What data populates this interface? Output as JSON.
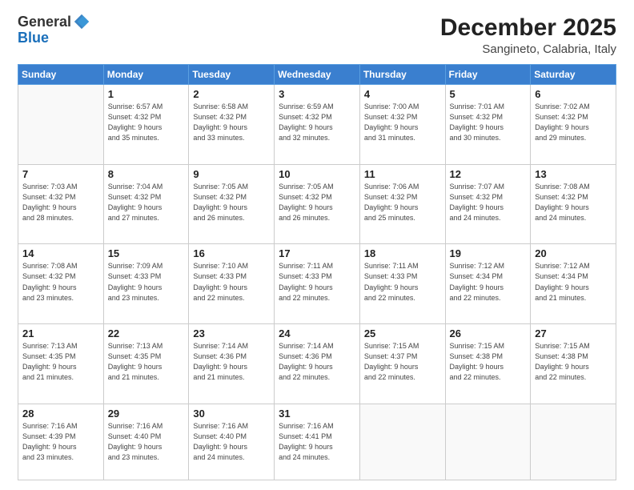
{
  "logo": {
    "general": "General",
    "blue": "Blue"
  },
  "header": {
    "month": "December 2025",
    "location": "Sangineto, Calabria, Italy"
  },
  "weekdays": [
    "Sunday",
    "Monday",
    "Tuesday",
    "Wednesday",
    "Thursday",
    "Friday",
    "Saturday"
  ],
  "weeks": [
    [
      {
        "day": "",
        "sunrise": "",
        "sunset": "",
        "daylight": ""
      },
      {
        "day": "1",
        "sunrise": "Sunrise: 6:57 AM",
        "sunset": "Sunset: 4:32 PM",
        "daylight": "Daylight: 9 hours and 35 minutes."
      },
      {
        "day": "2",
        "sunrise": "Sunrise: 6:58 AM",
        "sunset": "Sunset: 4:32 PM",
        "daylight": "Daylight: 9 hours and 33 minutes."
      },
      {
        "day": "3",
        "sunrise": "Sunrise: 6:59 AM",
        "sunset": "Sunset: 4:32 PM",
        "daylight": "Daylight: 9 hours and 32 minutes."
      },
      {
        "day": "4",
        "sunrise": "Sunrise: 7:00 AM",
        "sunset": "Sunset: 4:32 PM",
        "daylight": "Daylight: 9 hours and 31 minutes."
      },
      {
        "day": "5",
        "sunrise": "Sunrise: 7:01 AM",
        "sunset": "Sunset: 4:32 PM",
        "daylight": "Daylight: 9 hours and 30 minutes."
      },
      {
        "day": "6",
        "sunrise": "Sunrise: 7:02 AM",
        "sunset": "Sunset: 4:32 PM",
        "daylight": "Daylight: 9 hours and 29 minutes."
      }
    ],
    [
      {
        "day": "7",
        "sunrise": "Sunrise: 7:03 AM",
        "sunset": "Sunset: 4:32 PM",
        "daylight": "Daylight: 9 hours and 28 minutes."
      },
      {
        "day": "8",
        "sunrise": "Sunrise: 7:04 AM",
        "sunset": "Sunset: 4:32 PM",
        "daylight": "Daylight: 9 hours and 27 minutes."
      },
      {
        "day": "9",
        "sunrise": "Sunrise: 7:05 AM",
        "sunset": "Sunset: 4:32 PM",
        "daylight": "Daylight: 9 hours and 26 minutes."
      },
      {
        "day": "10",
        "sunrise": "Sunrise: 7:05 AM",
        "sunset": "Sunset: 4:32 PM",
        "daylight": "Daylight: 9 hours and 26 minutes."
      },
      {
        "day": "11",
        "sunrise": "Sunrise: 7:06 AM",
        "sunset": "Sunset: 4:32 PM",
        "daylight": "Daylight: 9 hours and 25 minutes."
      },
      {
        "day": "12",
        "sunrise": "Sunrise: 7:07 AM",
        "sunset": "Sunset: 4:32 PM",
        "daylight": "Daylight: 9 hours and 24 minutes."
      },
      {
        "day": "13",
        "sunrise": "Sunrise: 7:08 AM",
        "sunset": "Sunset: 4:32 PM",
        "daylight": "Daylight: 9 hours and 24 minutes."
      }
    ],
    [
      {
        "day": "14",
        "sunrise": "Sunrise: 7:08 AM",
        "sunset": "Sunset: 4:32 PM",
        "daylight": "Daylight: 9 hours and 23 minutes."
      },
      {
        "day": "15",
        "sunrise": "Sunrise: 7:09 AM",
        "sunset": "Sunset: 4:33 PM",
        "daylight": "Daylight: 9 hours and 23 minutes."
      },
      {
        "day": "16",
        "sunrise": "Sunrise: 7:10 AM",
        "sunset": "Sunset: 4:33 PM",
        "daylight": "Daylight: 9 hours and 22 minutes."
      },
      {
        "day": "17",
        "sunrise": "Sunrise: 7:11 AM",
        "sunset": "Sunset: 4:33 PM",
        "daylight": "Daylight: 9 hours and 22 minutes."
      },
      {
        "day": "18",
        "sunrise": "Sunrise: 7:11 AM",
        "sunset": "Sunset: 4:33 PM",
        "daylight": "Daylight: 9 hours and 22 minutes."
      },
      {
        "day": "19",
        "sunrise": "Sunrise: 7:12 AM",
        "sunset": "Sunset: 4:34 PM",
        "daylight": "Daylight: 9 hours and 22 minutes."
      },
      {
        "day": "20",
        "sunrise": "Sunrise: 7:12 AM",
        "sunset": "Sunset: 4:34 PM",
        "daylight": "Daylight: 9 hours and 21 minutes."
      }
    ],
    [
      {
        "day": "21",
        "sunrise": "Sunrise: 7:13 AM",
        "sunset": "Sunset: 4:35 PM",
        "daylight": "Daylight: 9 hours and 21 minutes."
      },
      {
        "day": "22",
        "sunrise": "Sunrise: 7:13 AM",
        "sunset": "Sunset: 4:35 PM",
        "daylight": "Daylight: 9 hours and 21 minutes."
      },
      {
        "day": "23",
        "sunrise": "Sunrise: 7:14 AM",
        "sunset": "Sunset: 4:36 PM",
        "daylight": "Daylight: 9 hours and 21 minutes."
      },
      {
        "day": "24",
        "sunrise": "Sunrise: 7:14 AM",
        "sunset": "Sunset: 4:36 PM",
        "daylight": "Daylight: 9 hours and 22 minutes."
      },
      {
        "day": "25",
        "sunrise": "Sunrise: 7:15 AM",
        "sunset": "Sunset: 4:37 PM",
        "daylight": "Daylight: 9 hours and 22 minutes."
      },
      {
        "day": "26",
        "sunrise": "Sunrise: 7:15 AM",
        "sunset": "Sunset: 4:38 PM",
        "daylight": "Daylight: 9 hours and 22 minutes."
      },
      {
        "day": "27",
        "sunrise": "Sunrise: 7:15 AM",
        "sunset": "Sunset: 4:38 PM",
        "daylight": "Daylight: 9 hours and 22 minutes."
      }
    ],
    [
      {
        "day": "28",
        "sunrise": "Sunrise: 7:16 AM",
        "sunset": "Sunset: 4:39 PM",
        "daylight": "Daylight: 9 hours and 23 minutes."
      },
      {
        "day": "29",
        "sunrise": "Sunrise: 7:16 AM",
        "sunset": "Sunset: 4:40 PM",
        "daylight": "Daylight: 9 hours and 23 minutes."
      },
      {
        "day": "30",
        "sunrise": "Sunrise: 7:16 AM",
        "sunset": "Sunset: 4:40 PM",
        "daylight": "Daylight: 9 hours and 24 minutes."
      },
      {
        "day": "31",
        "sunrise": "Sunrise: 7:16 AM",
        "sunset": "Sunset: 4:41 PM",
        "daylight": "Daylight: 9 hours and 24 minutes."
      },
      {
        "day": "",
        "sunrise": "",
        "sunset": "",
        "daylight": ""
      },
      {
        "day": "",
        "sunrise": "",
        "sunset": "",
        "daylight": ""
      },
      {
        "day": "",
        "sunrise": "",
        "sunset": "",
        "daylight": ""
      }
    ]
  ]
}
